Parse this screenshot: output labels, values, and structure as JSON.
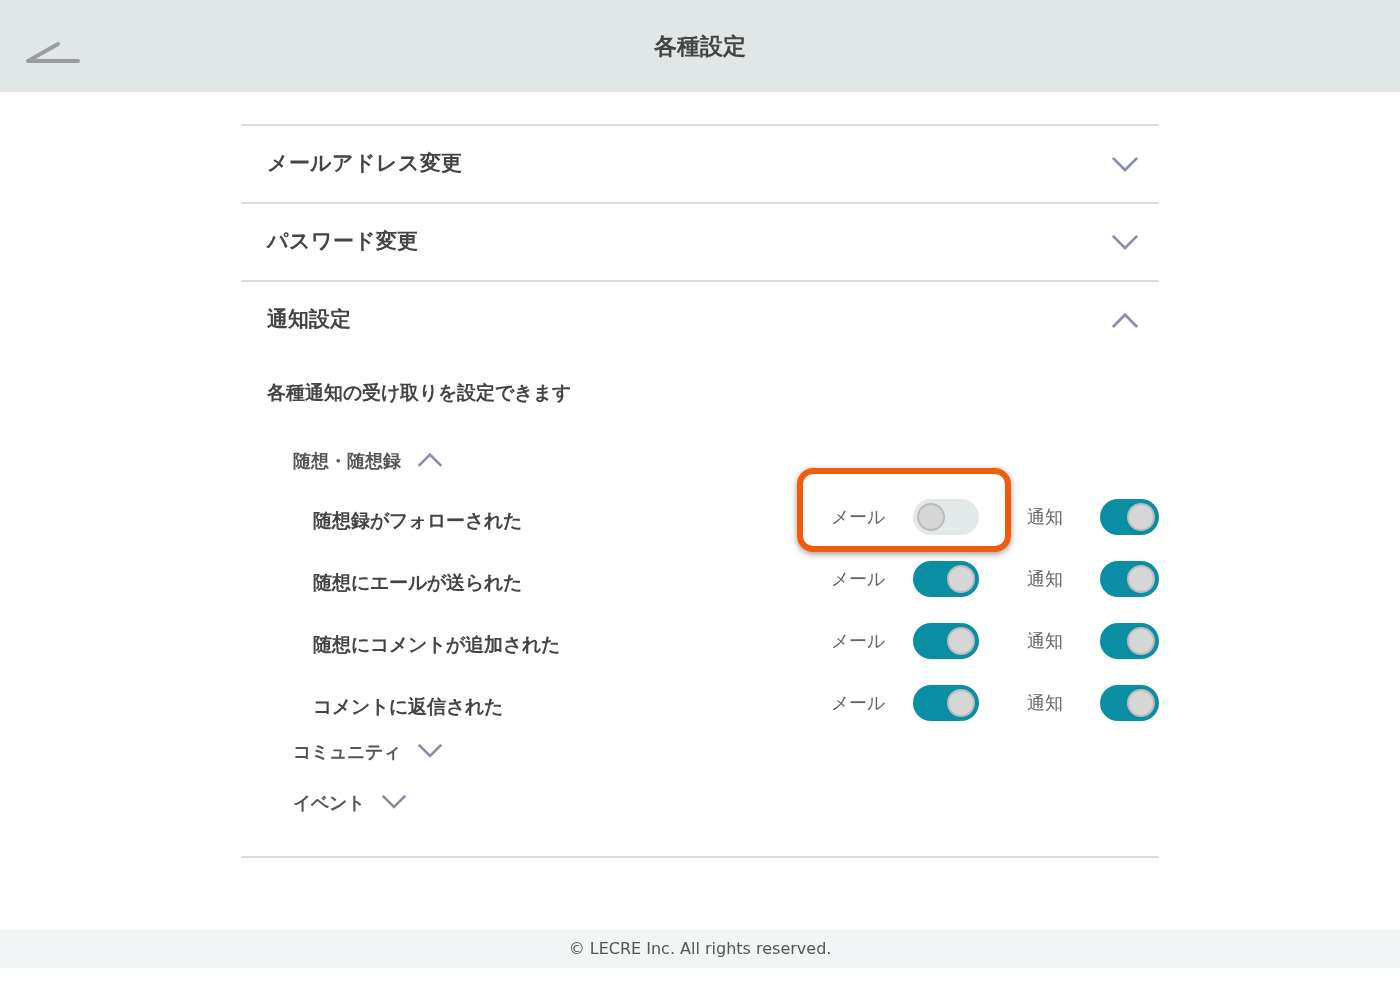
{
  "header": {
    "title": "各種設定"
  },
  "sections": [
    {
      "title": "メールアドレス変更",
      "expanded": false
    },
    {
      "title": "パスワード変更",
      "expanded": false
    },
    {
      "title": "通知設定",
      "expanded": true,
      "description": "各種通知の受け取りを設定できます",
      "groups": [
        {
          "title": "随想・随想録",
          "expanded": true,
          "items": [
            {
              "label": "随想録がフォローされた",
              "mail_label": "メール",
              "mail_on": false,
              "mail_highlighted": true,
              "notify_label": "通知",
              "notify_on": true
            },
            {
              "label": "随想にエールが送られた",
              "mail_label": "メール",
              "mail_on": true,
              "mail_highlighted": false,
              "notify_label": "通知",
              "notify_on": true
            },
            {
              "label": "随想にコメントが追加された",
              "mail_label": "メール",
              "mail_on": true,
              "mail_highlighted": false,
              "notify_label": "通知",
              "notify_on": true
            },
            {
              "label": "コメントに返信された",
              "mail_label": "メール",
              "mail_on": true,
              "mail_highlighted": false,
              "notify_label": "通知",
              "notify_on": true
            }
          ]
        },
        {
          "title": "コミュニティ",
          "expanded": false
        },
        {
          "title": "イベント",
          "expanded": false
        }
      ]
    }
  ],
  "footer": {
    "copyright": "© LECRE Inc. All rights reserved."
  }
}
